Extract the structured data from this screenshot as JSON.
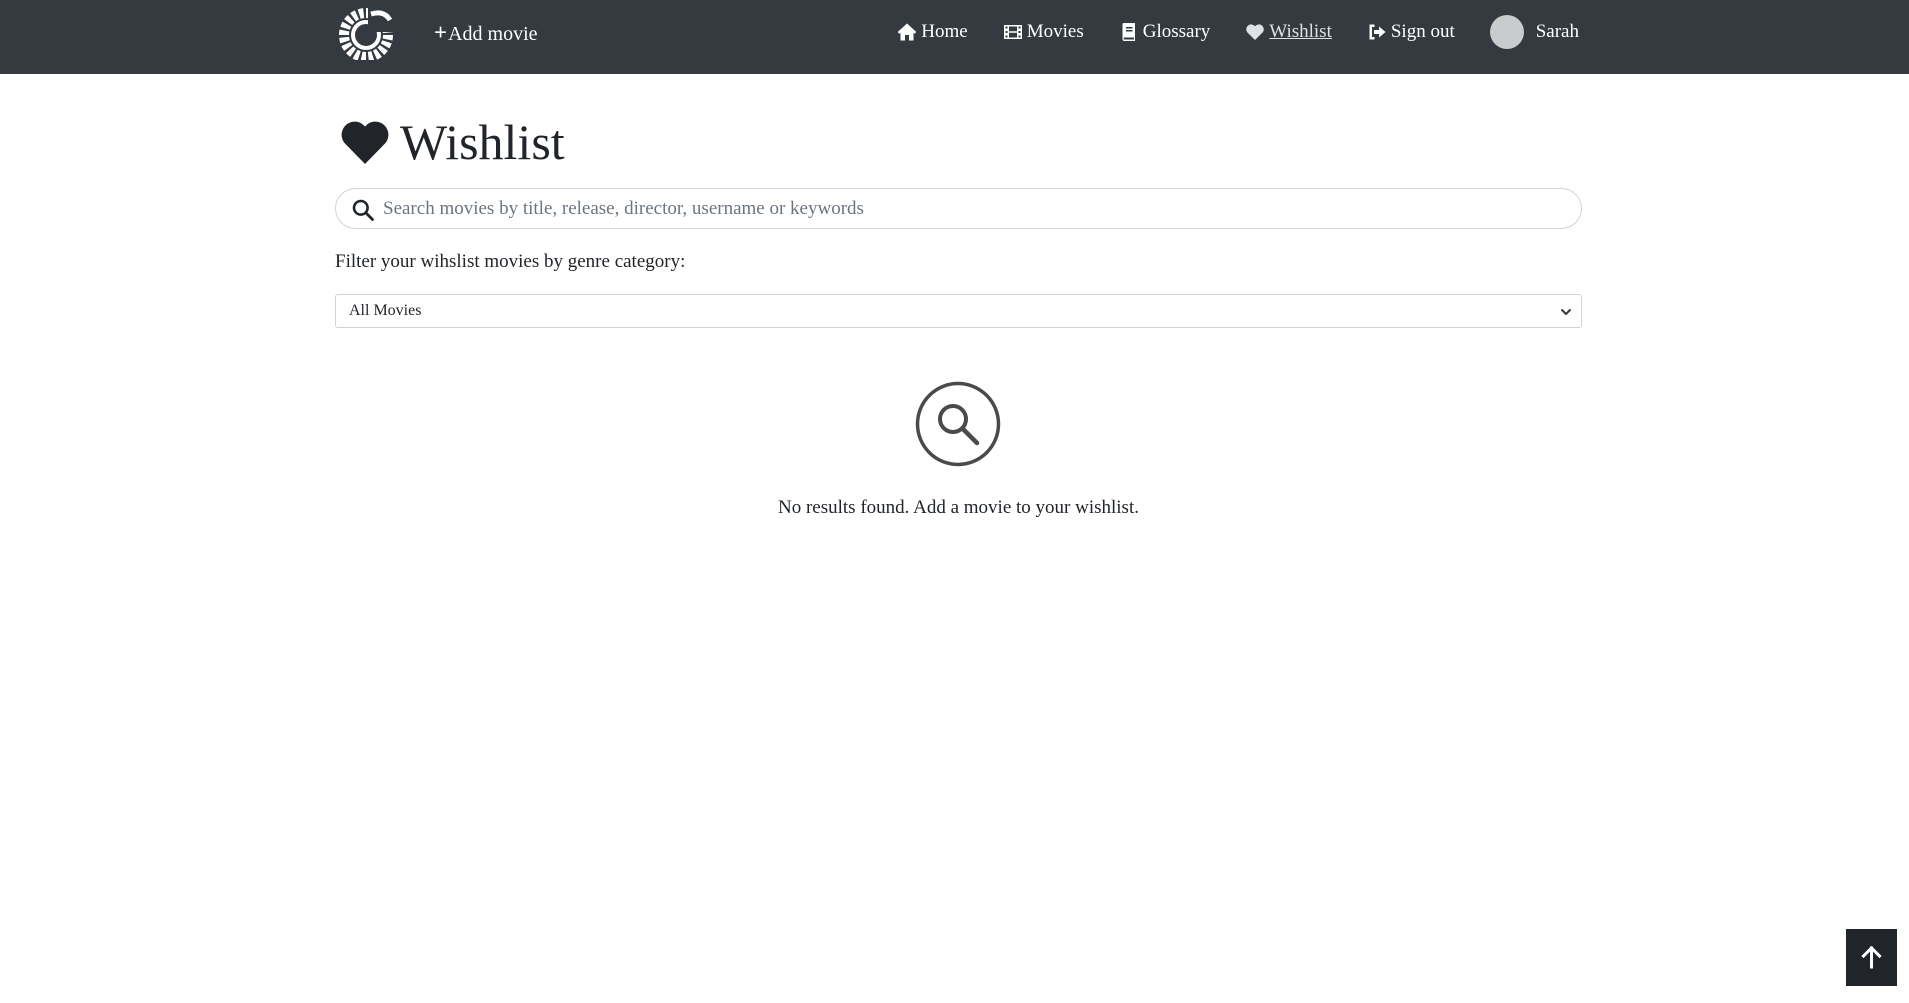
{
  "navbar": {
    "logo_icon": "spiral-film-logo-icon",
    "add_movie_label": "Add movie",
    "add_movie_icon": "plus-icon",
    "links": [
      {
        "label": "Home",
        "icon": "home-icon"
      },
      {
        "label": "Movies",
        "icon": "film-icon"
      },
      {
        "label": "Glossary",
        "icon": "book-icon"
      },
      {
        "label": "Wishlist",
        "icon": "heart-icon",
        "active": true
      },
      {
        "label": "Sign out",
        "icon": "sign-out-icon"
      }
    ],
    "user": {
      "name": "Sarah"
    },
    "background_color": "#343a40"
  },
  "page": {
    "title": "Wishlist",
    "title_icon": "heart-icon"
  },
  "search": {
    "placeholder": "Search movies by title, release, director, username or keywords",
    "value": "",
    "icon": "search-icon"
  },
  "filter": {
    "label": "Filter your wihslist movies by genre category:",
    "selected": "All Movies"
  },
  "empty_state": {
    "icon": "search-circle-icon",
    "message": "No results found. Add a movie to your wishlist."
  },
  "back_to_top": {
    "icon": "arrow-up-icon"
  }
}
